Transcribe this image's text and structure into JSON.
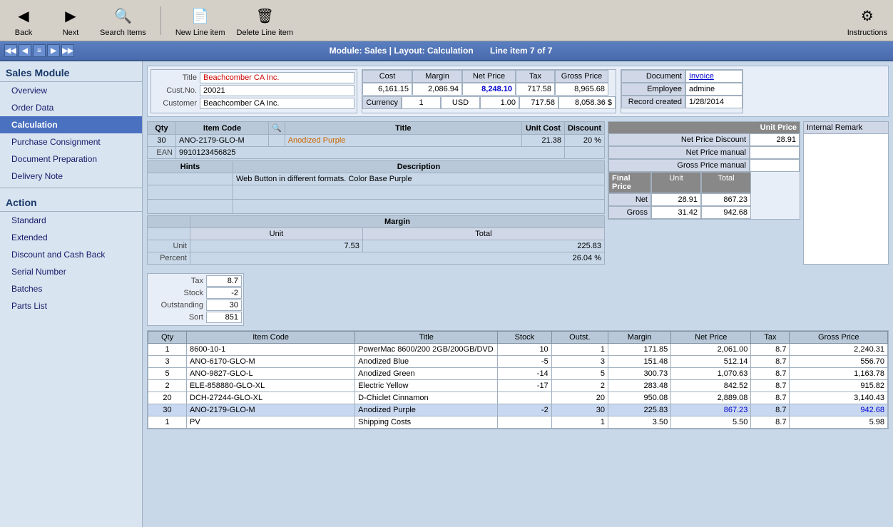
{
  "toolbar": {
    "back_label": "Back",
    "next_label": "Next",
    "search_label": "Search Items",
    "newline_label": "New Line item",
    "delete_label": "Delete Line item",
    "instructions_label": "Instructions"
  },
  "navBar": {
    "module_layout": "Module: Sales | Layout: Calculation",
    "line_item": "Line item 7 of 7",
    "arrows": [
      "◀◀",
      "◀",
      "≡",
      "▶",
      "▶▶"
    ]
  },
  "sidebar": {
    "sales_module_title": "Sales Module",
    "items": [
      {
        "label": "Overview",
        "active": false
      },
      {
        "label": "Order Data",
        "active": false
      },
      {
        "label": "Calculation",
        "active": true
      },
      {
        "label": "Purchase Consignment",
        "active": false
      },
      {
        "label": "Document Preparation",
        "active": false
      },
      {
        "label": "Delivery Note",
        "active": false
      }
    ],
    "action_title": "Action",
    "action_items": [
      {
        "label": "Standard",
        "active": false
      },
      {
        "label": "Extended",
        "active": false
      },
      {
        "label": "Discount and Cash Back",
        "active": false
      },
      {
        "label": "Serial Number",
        "active": false
      },
      {
        "label": "Batches",
        "active": false
      },
      {
        "label": "Parts List",
        "active": false
      }
    ]
  },
  "header": {
    "title_label": "Title",
    "title_value": "Beachcomber CA Inc.",
    "custno_label": "Cust.No.",
    "custno_value": "20021",
    "customer_label": "Customer",
    "customer_value": "Beachcomber CA Inc.",
    "cost_label": "Cost",
    "cost_value": "6,161.15",
    "margin_label": "Margin",
    "margin_value": "2,086.94",
    "netprice_label": "Net Price",
    "netprice_value": "8,248.10",
    "tax_label": "Tax",
    "tax_value": "717.58",
    "grossprice_label": "Gross Price",
    "grossprice_value": "8,965.68",
    "currency_label": "Currency",
    "currency_code": "1",
    "currency_name": "USD",
    "currency_rate": "1.00",
    "currency_tax": "717.58",
    "currency_amount": "8,058.36 $",
    "document_label": "Document",
    "document_value": "Invoice",
    "employee_label": "Employee",
    "employee_value": "admine",
    "record_label": "Record created",
    "record_value": "1/28/2014"
  },
  "itemDetail": {
    "qty_header": "Qty",
    "itemcode_header": "Item Code",
    "title_header": "Title",
    "unitcost_header": "Unit Cost",
    "discount_header": "Discount",
    "qty_value": "30",
    "itemcode_value": "ANO-2179-GLO-M",
    "title_value": "Anodized Purple",
    "ean_label": "EAN",
    "ean_value": "9910123456825",
    "unitcost_value": "21.38",
    "discount_value": "20 %",
    "hints_label": "Hints",
    "description_label": "Description",
    "description_value": "Web Button in different formats. Color Base Purple",
    "margin_label": "Margin",
    "unit_label": "Unit",
    "total_label": "Total",
    "unit_value": "7.53",
    "total_value": "225.83",
    "percent_label": "Percent",
    "percent_value": "26.04 %",
    "unitprice_header": "Unit Price",
    "net_price_discount_label": "Net Price Discount",
    "net_price_discount_value": "28.91",
    "net_price_manual_label": "Net Price manual",
    "net_price_manual_value": "",
    "gross_price_manual_label": "Gross Price manual",
    "gross_price_manual_value": "",
    "final_price_header": "Final Price",
    "final_unit_header": "Unit",
    "final_total_header": "Total",
    "net_label": "Net",
    "net_unit_value": "28.91",
    "net_total_value": "867.23",
    "gross_label": "Gross",
    "gross_unit_value": "31.42",
    "gross_total_value": "942.68",
    "internal_remark_label": "Internal Remark"
  },
  "taxStock": {
    "tax_label": "Tax",
    "tax_value": "8.7",
    "stock_label": "Stock",
    "stock_value": "-2",
    "outstanding_label": "Outstanding",
    "outstanding_value": "30",
    "sort_label": "Sort",
    "sort_value": "851"
  },
  "bottomTable": {
    "headers": [
      "Qty",
      "Item Code",
      "Title",
      "Stock",
      "Outst.",
      "Margin",
      "Net Price",
      "Tax",
      "Gross Price"
    ],
    "rows": [
      {
        "qty": "1",
        "itemcode": "8600-10-1",
        "title": "PowerMac 8600/200 2GB/200GB/DVD",
        "stock": "10",
        "outst": "1",
        "margin": "171.85",
        "netprice": "2,061.00",
        "tax": "8.7",
        "grossprice": "2,240.31",
        "highlight": false
      },
      {
        "qty": "3",
        "itemcode": "ANO-6170-GLO-M",
        "title": "Anodized Blue",
        "stock": "-5",
        "outst": "3",
        "margin": "151.48",
        "netprice": "512.14",
        "tax": "8.7",
        "grossprice": "556.70",
        "highlight": false
      },
      {
        "qty": "5",
        "itemcode": "ANO-9827-GLO-L",
        "title": "Anodized Green",
        "stock": "-14",
        "outst": "5",
        "margin": "300.73",
        "netprice": "1,070.63",
        "tax": "8.7",
        "grossprice": "1,163.78",
        "highlight": false
      },
      {
        "qty": "2",
        "itemcode": "ELE-858880-GLO-XL",
        "title": "Electric Yellow",
        "stock": "-17",
        "outst": "2",
        "margin": "283.48",
        "netprice": "842.52",
        "tax": "8.7",
        "grossprice": "915.82",
        "highlight": false
      },
      {
        "qty": "20",
        "itemcode": "DCH-27244-GLO-XL",
        "title": "D-Chiclet Cinnamon",
        "stock": "",
        "outst": "20",
        "margin": "950.08",
        "netprice": "2,889.08",
        "tax": "8.7",
        "grossprice": "3,140.43",
        "highlight": false
      },
      {
        "qty": "30",
        "itemcode": "ANO-2179-GLO-M",
        "title": "Anodized Purple",
        "stock": "-2",
        "outst": "30",
        "margin": "225.83",
        "netprice": "867.23",
        "tax": "8.7",
        "grossprice": "942.68",
        "highlight": true
      },
      {
        "qty": "1",
        "itemcode": "PV",
        "title": "Shipping Costs",
        "stock": "",
        "outst": "1",
        "margin": "3.50",
        "netprice": "5.50",
        "tax": "8.7",
        "grossprice": "5.98",
        "highlight": false
      }
    ]
  }
}
